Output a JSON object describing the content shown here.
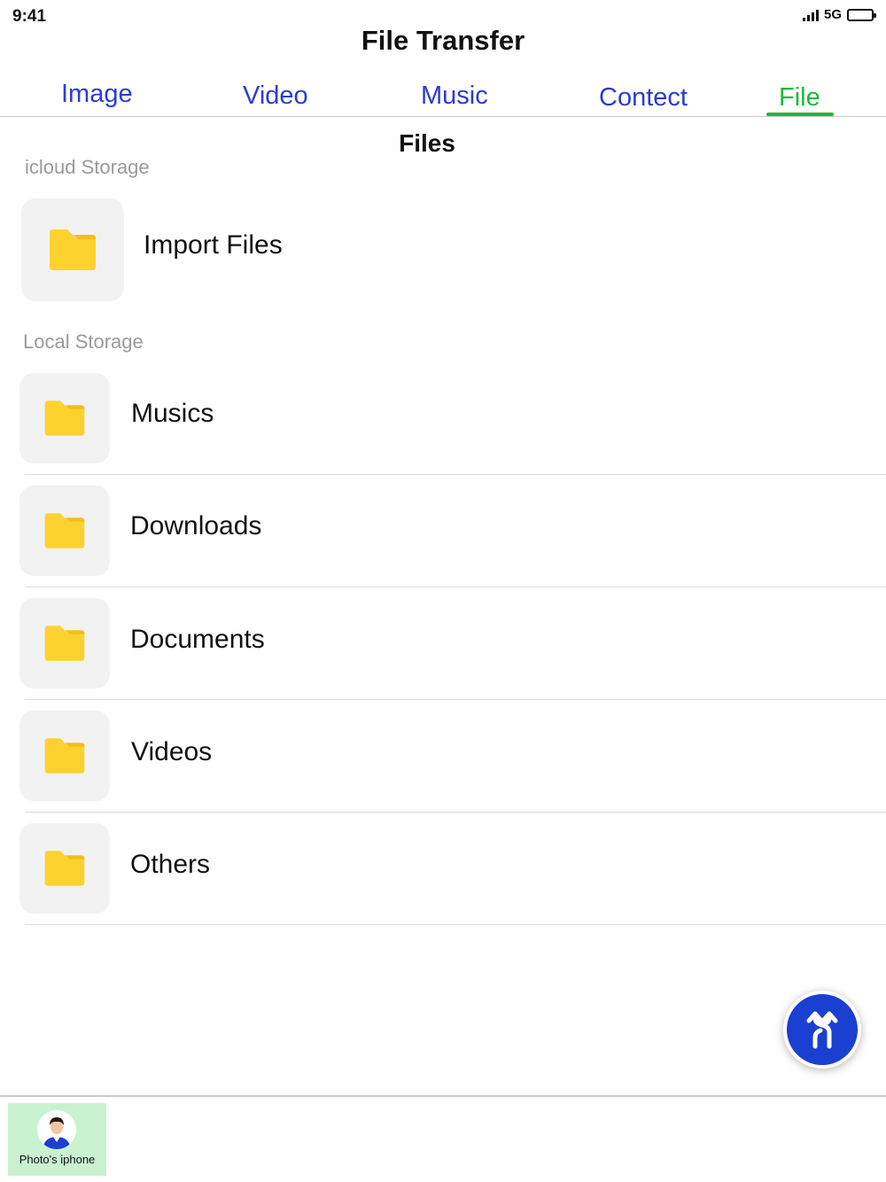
{
  "status_bar": {
    "time": "9:41",
    "network": "5G"
  },
  "app": {
    "title": "File Transfer"
  },
  "tabs": [
    {
      "label": "Image",
      "active": false
    },
    {
      "label": "Video",
      "active": false
    },
    {
      "label": "Music",
      "active": false
    },
    {
      "label": "Contect",
      "active": false
    },
    {
      "label": "File",
      "active": true
    }
  ],
  "section_title": "Files",
  "icloud": {
    "label": "icloud Storage",
    "import": {
      "label": "Import Files",
      "icon": "folder-icon"
    }
  },
  "local": {
    "label": "Local Storage",
    "folders": [
      {
        "label": "Musics",
        "icon": "folder-icon"
      },
      {
        "label": "Downloads",
        "icon": "folder-icon"
      },
      {
        "label": "Documents",
        "icon": "folder-icon"
      },
      {
        "label": "Videos",
        "icon": "folder-icon"
      },
      {
        "label": "Others",
        "icon": "folder-icon"
      }
    ]
  },
  "fab": {
    "icon": "transfer-arrows-icon"
  },
  "device": {
    "name": "Photo's iphone",
    "icon": "avatar"
  },
  "colors": {
    "tab_text": "#2d3bd0",
    "tab_active": "#1db83a",
    "folder": "#fdd22f",
    "fab": "#1b3fd0",
    "device_chip": "#c9f2d1"
  }
}
